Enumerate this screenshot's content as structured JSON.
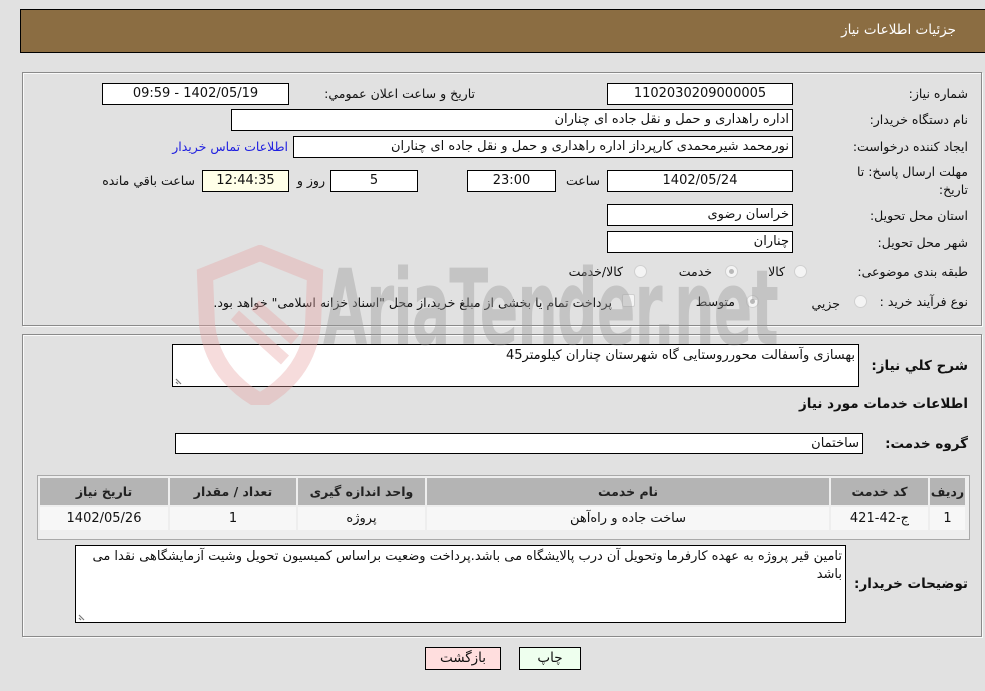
{
  "header": {
    "title": "جزئيات اطلاعات نیاز"
  },
  "details": {
    "need_number": {
      "label": "شماره نیاز:",
      "value": "1102030209000005"
    },
    "announce_datetime": {
      "label": "تاریخ و ساعت اعلان عمومي:",
      "value": "1402/05/19 - 09:59"
    },
    "buyer_org": {
      "label": "نام دستگاه خریدار:",
      "value": "اداره راهداری و حمل و نقل جاده ای چناران"
    },
    "requester": {
      "label": "ایجاد کننده درخواست:",
      "value": "نورمحمد شیرمحمدی کارپرداز اداره راهداری و حمل و نقل جاده ای چناران",
      "contact_link": "اطلاعات تماس خریدار"
    },
    "deadline": {
      "label_line1": "مهلت ارسال پاسخ: تا",
      "label_line2": "تاریخ:",
      "date": "1402/05/24",
      "time_label": "ساعت",
      "time": "23:00",
      "days": "5",
      "days_label": "روز و",
      "remaining": "12:44:35",
      "remaining_label": "ساعت باقي مانده"
    },
    "province": {
      "label": "استان محل تحویل:",
      "value": "خراسان رضوی"
    },
    "city": {
      "label": "شهر محل تحویل:",
      "value": "چناران"
    },
    "category": {
      "label": "طبقه بندی موضوعی:",
      "options": [
        {
          "label": "کالا",
          "selected": false
        },
        {
          "label": "خدمت",
          "selected": true
        },
        {
          "label": "کالا/خدمت",
          "selected": false
        }
      ]
    },
    "process": {
      "label": "نوع فرآیند خرید :",
      "options": [
        {
          "label": "جزيي",
          "selected": false
        },
        {
          "label": "متوسط",
          "selected": true
        }
      ],
      "treasury_checkbox": {
        "label": "پرداخت تمام یا بخشی از مبلغ خرید،از محل \"اسناد خزانه اسلامی\" خواهد بود.",
        "checked": false
      }
    }
  },
  "needs": {
    "description_label": "شرح کلي نیاز:",
    "description": "بهسازی وآسفالت محورروستایی گاه شهرستان چناران کیلومتر45",
    "services_heading": "اطلاعات خدمات مورد نیاز",
    "service_group_label": "گروه خدمت:",
    "service_group": "ساختمان",
    "buyer_notes_label": "توضیحات خریدار:",
    "buyer_notes": "تامین قیر پروژه به عهده کارفرما وتحویل آن درب پالایشگاه می باشد.پرداخت وضعیت براساس کمیسیون تحویل وشیت آزمایشگاهی نقدا می باشد"
  },
  "table": {
    "columns": [
      "ردیف",
      "کد خدمت",
      "نام خدمت",
      "واحد اندازه گیری",
      "تعداد / مقدار",
      "تاریخ نیاز"
    ],
    "rows": [
      [
        "1",
        "ج-42-421",
        "ساخت جاده و راه‌آهن",
        "پروژه",
        "1",
        "1402/05/26"
      ]
    ]
  },
  "buttons": {
    "print": "چاپ",
    "back": "بازگشت"
  },
  "watermark": {
    "text": "AriaTender.net"
  },
  "colors": {
    "header_bg": "#8b6d42",
    "page_bg": "#e1e1e1",
    "link": "#2020e0",
    "back_button_bg": "#ffdede",
    "print_button_bg": "#eeffee",
    "remaining_time_bg": "#ffffe8",
    "table_header_bg": "#b4b4b4"
  }
}
